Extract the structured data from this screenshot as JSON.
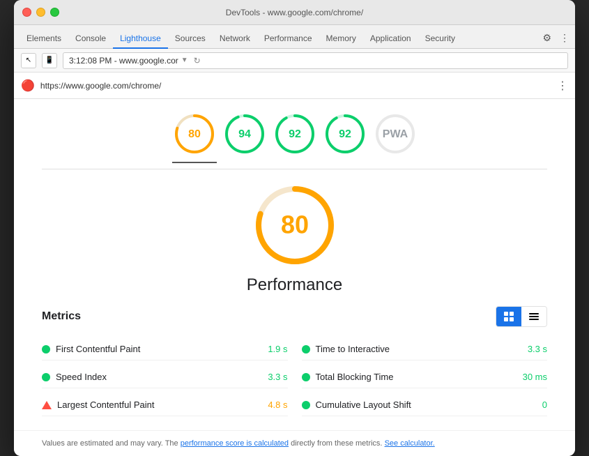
{
  "titleBar": {
    "title": "DevTools - www.google.com/chrome/"
  },
  "tabs": [
    {
      "label": "Elements",
      "active": false
    },
    {
      "label": "Console",
      "active": false
    },
    {
      "label": "Lighthouse",
      "active": true
    },
    {
      "label": "Sources",
      "active": false
    },
    {
      "label": "Network",
      "active": false
    },
    {
      "label": "Performance",
      "active": false
    },
    {
      "label": "Memory",
      "active": false
    },
    {
      "label": "Application",
      "active": false
    },
    {
      "label": "Security",
      "active": false
    }
  ],
  "addressBar": {
    "tab": "3:12:08 PM - www.google.cor",
    "url": "https://www.google.com/chrome/"
  },
  "scores": [
    {
      "value": "80",
      "color": "#ffa400",
      "strokeColor": "#ffa400",
      "active": true
    },
    {
      "value": "94",
      "color": "#0cce6b",
      "strokeColor": "#0cce6b",
      "active": false
    },
    {
      "value": "92",
      "color": "#0cce6b",
      "strokeColor": "#0cce6b",
      "active": false
    },
    {
      "value": "92",
      "color": "#0cce6b",
      "strokeColor": "#0cce6b",
      "active": false
    },
    {
      "value": "PWA",
      "color": "#9aa0a6",
      "strokeColor": "#9aa0a6",
      "active": false
    }
  ],
  "mainScore": {
    "value": "80",
    "color": "#ffa400",
    "title": "Performance"
  },
  "metrics": {
    "title": "Metrics",
    "items": [
      {
        "name": "First Contentful Paint",
        "value": "1.9 s",
        "status": "green",
        "col": 0
      },
      {
        "name": "Time to Interactive",
        "value": "3.3 s",
        "status": "green",
        "col": 1
      },
      {
        "name": "Speed Index",
        "value": "3.3 s",
        "status": "green",
        "col": 0
      },
      {
        "name": "Total Blocking Time",
        "value": "30 ms",
        "status": "green",
        "col": 1
      },
      {
        "name": "Largest Contentful Paint",
        "value": "4.8 s",
        "status": "orange",
        "col": 0,
        "triangle": true
      },
      {
        "name": "Cumulative Layout Shift",
        "value": "0",
        "status": "green",
        "col": 1
      }
    ]
  },
  "note": {
    "prefix": "Values are estimated and may vary. The ",
    "link1": "performance score is calculated",
    "middle": " directly from these metrics. ",
    "link2": "See calculator."
  },
  "viewBtns": [
    {
      "label": "≡≡",
      "active": true
    },
    {
      "label": "☰",
      "active": false
    }
  ]
}
